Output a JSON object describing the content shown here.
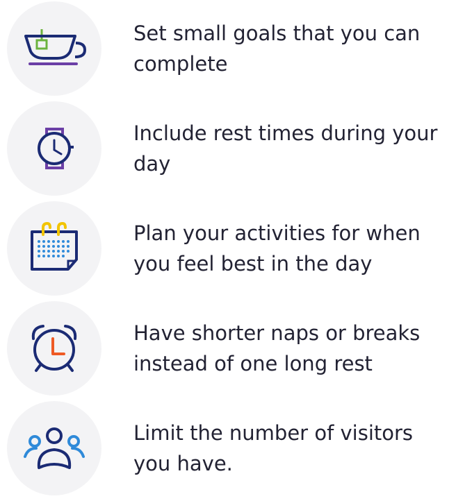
{
  "colors": {
    "icon_circle": "#f3f3f5",
    "icon_navy": "#1b2b74",
    "icon_purple": "#6b3fa6",
    "icon_blue": "#2f8ad9",
    "icon_yellow": "#f2c400",
    "icon_orange": "#ee5a24",
    "icon_green": "#6cb33f",
    "text": "#222233"
  },
  "tips": [
    {
      "icon": "teacup-icon",
      "text": "Set small goals that you can complete"
    },
    {
      "icon": "wristwatch-icon",
      "text": "Include rest times during your day"
    },
    {
      "icon": "calendar-icon",
      "text": "Plan your activities for when you feel best in the day"
    },
    {
      "icon": "alarm-clock-icon",
      "text": "Have shorter naps or breaks instead of one long rest"
    },
    {
      "icon": "people-icon",
      "text": "Limit the number of visitors you have."
    }
  ]
}
